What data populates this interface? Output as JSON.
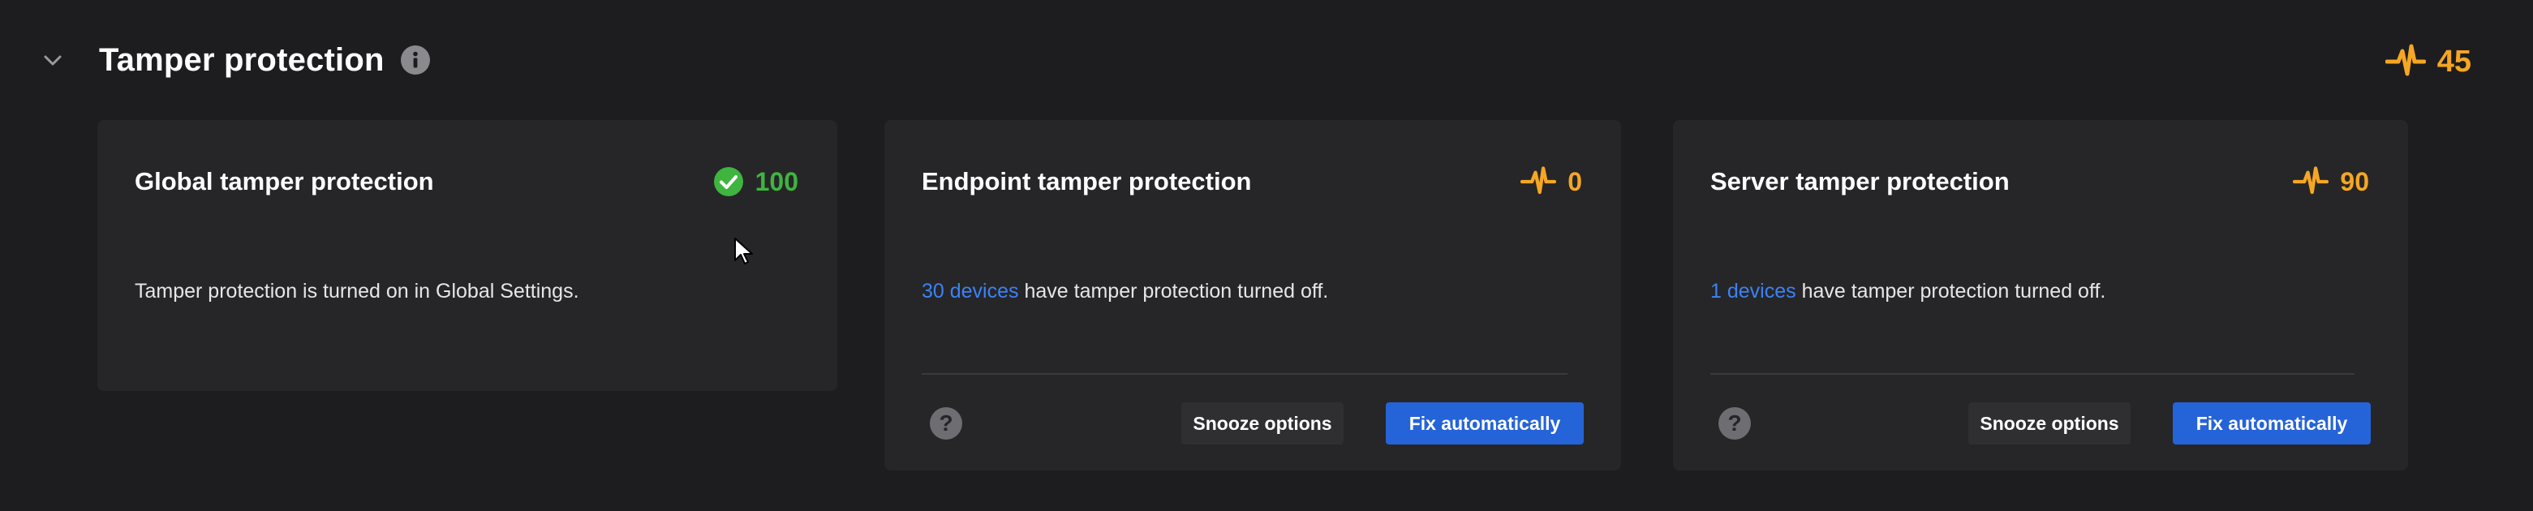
{
  "section": {
    "title": "Tamper protection",
    "score": "45",
    "icons": {
      "collapse": "chevron-down-icon",
      "info": "info-icon",
      "score": "pulse-warning-icon"
    }
  },
  "colors": {
    "background": "#1d1d1f",
    "card": "#262628",
    "good": "#3fb43f",
    "warning": "#f5a623",
    "link": "#3b82f6",
    "primary_button": "#2563d8"
  },
  "cards": [
    {
      "title": "Global tamper protection",
      "score": "100",
      "status": "good",
      "message": "Tamper protection is turned on in Global Settings."
    },
    {
      "title": "Endpoint tamper protection",
      "score": "0",
      "status": "warning",
      "link_text": "30 devices",
      "message": " have tamper protection turned off.",
      "snooze_label": "Snooze options",
      "fix_label": "Fix automatically"
    },
    {
      "title": "Server tamper protection",
      "score": "90",
      "status": "warning",
      "link_text": "1 devices",
      "message": " have tamper protection turned off.",
      "snooze_label": "Snooze options",
      "fix_label": "Fix automatically"
    }
  ]
}
